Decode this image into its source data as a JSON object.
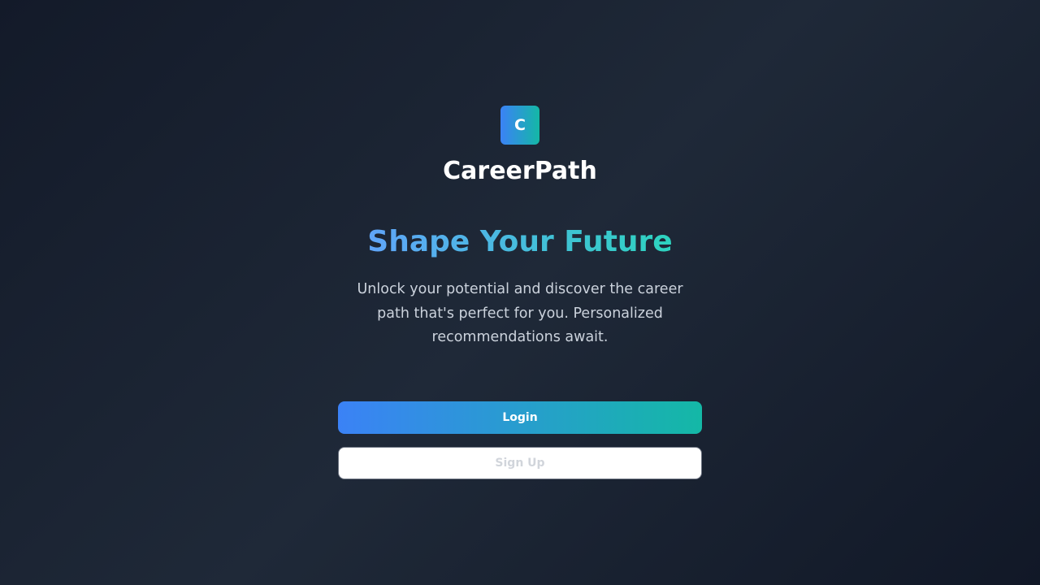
{
  "brand": {
    "logo_letter": "C",
    "name": "CareerPath"
  },
  "hero": {
    "headline": "Shape Your Future",
    "tagline": "Unlock your potential and discover the career path that's perfect for you. Personalized recommendations await."
  },
  "actions": {
    "login_label": "Login",
    "signup_label": "Sign Up"
  },
  "colors": {
    "accent_start": "#3b82f6",
    "accent_end": "#14b8a6",
    "background": "#1f2938"
  }
}
